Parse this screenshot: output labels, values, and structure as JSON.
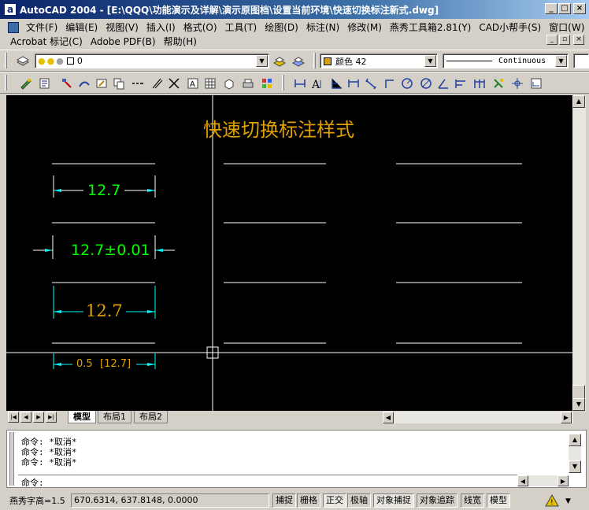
{
  "window": {
    "title": "AutoCAD 2004 - [E:\\QQQ\\功能演示及详解\\演示原图档\\设置当前环境\\快速切换标注新式.dwg]",
    "app_icon": "a",
    "min": "_",
    "max": "□",
    "close": "×",
    "doc_min": "_",
    "doc_restore": "▫",
    "doc_close": "×"
  },
  "menu": {
    "row1": [
      "文件(F)",
      "编辑(E)",
      "视图(V)",
      "插入(I)",
      "格式(O)",
      "工具(T)",
      "绘图(D)",
      "标注(N)",
      "修改(M)",
      "燕秀工具箱2.81(Y)",
      "CAD小帮手(S)",
      "窗口(W)"
    ],
    "row2": [
      "Acrobat 标记(C)",
      "Adobe PDF(B)",
      "帮助(H)"
    ]
  },
  "layer_toolbar": {
    "layer_value": "0",
    "color_value": "颜色 42",
    "linetype_value": "Continuous",
    "layer_swatch": "#ffffff",
    "color_swatch": "#d4a017"
  },
  "drawing": {
    "title": "快速切换标注样式",
    "title_color": "#e0a000",
    "dim1_text": "12.7",
    "dim1_color": "#00ff00",
    "dim2_text": "12.7±0.01",
    "dim2_color": "#00ff00",
    "dim3_text": "12.7",
    "dim3_color": "#e0a000",
    "dim4_text_a": "0.5",
    "dim4_text_b": "[12.7]",
    "dim4_color": "#e0a000",
    "arrow_color": "#00ffff",
    "line_color": "#ffffff"
  },
  "tabs": [
    "模型",
    "布局1",
    "布局2"
  ],
  "nav": [
    "|◀",
    "◀",
    "▶",
    "▶|"
  ],
  "command": {
    "history": [
      "命令: *取消*",
      "命令: *取消*",
      "命令: *取消*"
    ],
    "prompt": "命令:"
  },
  "status": {
    "text_height": "燕秀字高=1.5",
    "coords": "670.6314, 637.8148, 0.0000",
    "toggles": [
      "捕捉",
      "栅格",
      "正交",
      "极轴",
      "对象捕捉",
      "对象追踪",
      "线宽",
      "模型"
    ]
  }
}
